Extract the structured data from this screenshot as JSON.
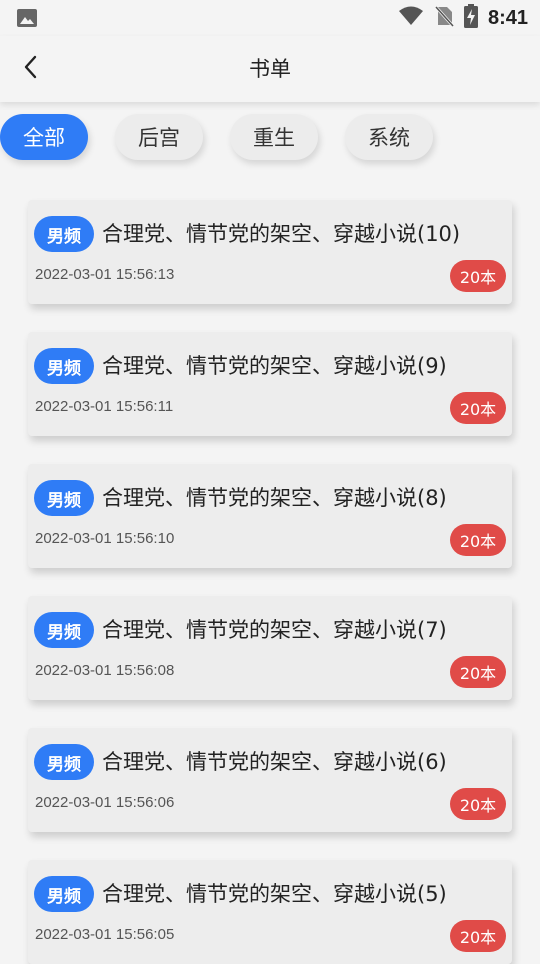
{
  "status_bar": {
    "time": "8:41",
    "icons": [
      "image-icon",
      "wifi-icon",
      "no-sim-icon",
      "battery-charging-icon"
    ]
  },
  "header": {
    "title": "书单",
    "back_icon": "chevron-left-icon"
  },
  "tabs": [
    {
      "label": "全部",
      "active": true
    },
    {
      "label": "后宫",
      "active": false
    },
    {
      "label": "重生",
      "active": false
    },
    {
      "label": "系统",
      "active": false
    }
  ],
  "colors": {
    "accent": "#2f7cf6",
    "count_badge": "#e04b48",
    "background": "#f4f4f4",
    "card": "#ededed"
  },
  "book_lists": [
    {
      "tag": "男频",
      "title": "合理党、情节党的架空、穿越小说(10)",
      "time": "2022-03-01 15:56:13",
      "count": "20本"
    },
    {
      "tag": "男频",
      "title": "合理党、情节党的架空、穿越小说(9)",
      "time": "2022-03-01 15:56:11",
      "count": "20本"
    },
    {
      "tag": "男频",
      "title": "合理党、情节党的架空、穿越小说(8)",
      "time": "2022-03-01 15:56:10",
      "count": "20本"
    },
    {
      "tag": "男频",
      "title": "合理党、情节党的架空、穿越小说(7)",
      "time": "2022-03-01 15:56:08",
      "count": "20本"
    },
    {
      "tag": "男频",
      "title": "合理党、情节党的架空、穿越小说(6)",
      "time": "2022-03-01 15:56:06",
      "count": "20本"
    },
    {
      "tag": "男频",
      "title": "合理党、情节党的架空、穿越小说(5)",
      "time": "2022-03-01 15:56:05",
      "count": "20本"
    }
  ]
}
